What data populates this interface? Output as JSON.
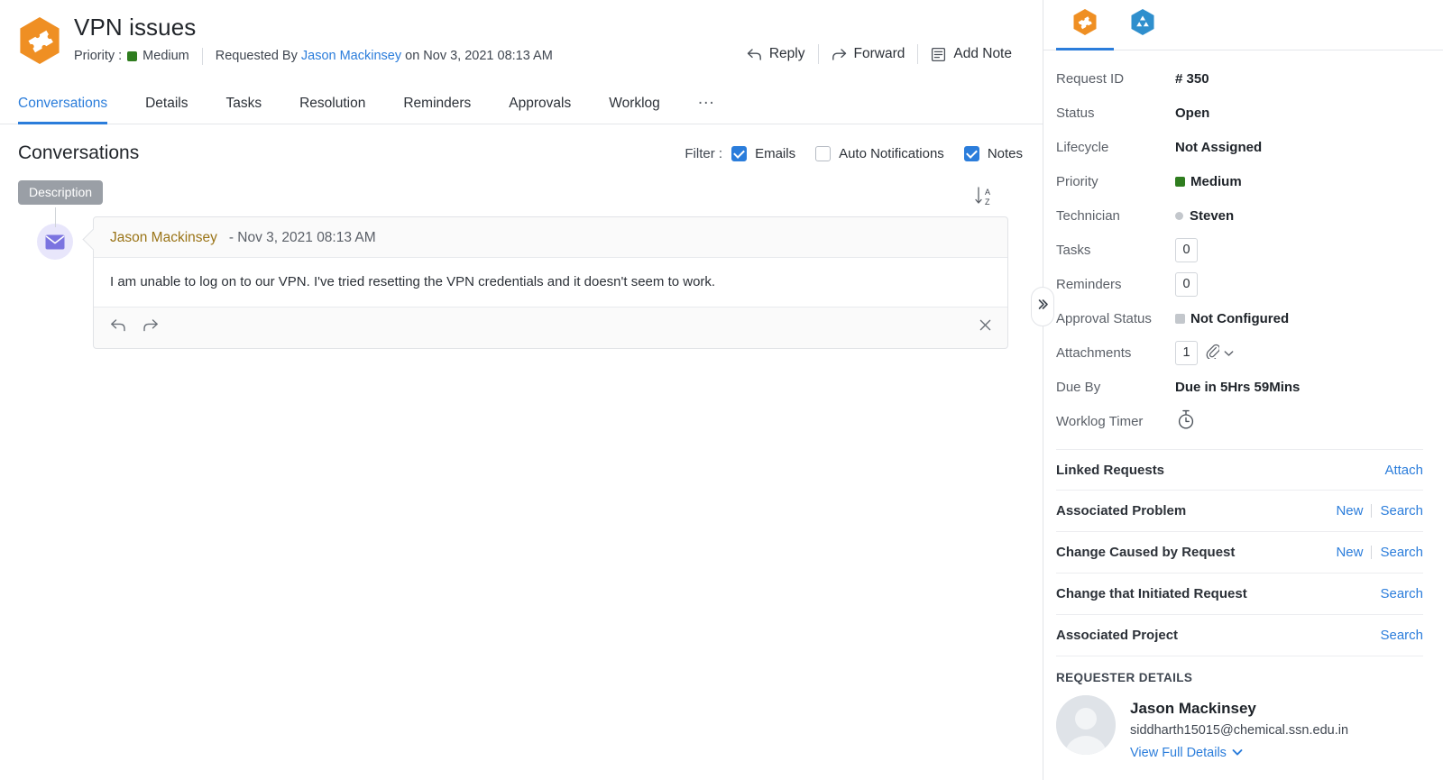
{
  "header": {
    "title": "VPN issues",
    "priority_label": "Priority :",
    "priority_value": "Medium",
    "priority_color": "#2f7d1f",
    "requested_by_label": "Requested By",
    "requester": "Jason Mackinsey",
    "requested_on": "on Nov 3, 2021 08:13 AM",
    "icon": "ticket-hex-icon",
    "actions": [
      {
        "label": "Reply",
        "icon": "reply-arrow-icon"
      },
      {
        "label": "Forward",
        "icon": "forward-arrow-icon"
      },
      {
        "label": "Add Note",
        "icon": "note-icon"
      }
    ]
  },
  "tabs": [
    {
      "label": "Conversations",
      "active": true
    },
    {
      "label": "Details",
      "active": false
    },
    {
      "label": "Tasks",
      "active": false
    },
    {
      "label": "Resolution",
      "active": false
    },
    {
      "label": "Reminders",
      "active": false
    },
    {
      "label": "Approvals",
      "active": false
    },
    {
      "label": "Worklog",
      "active": false
    },
    {
      "label": "...",
      "active": false
    }
  ],
  "conversations": {
    "heading": "Conversations",
    "filter_label": "Filter :",
    "filters": [
      {
        "label": "Emails",
        "checked": true
      },
      {
        "label": "Auto Notifications",
        "checked": false
      },
      {
        "label": "Notes",
        "checked": true
      }
    ],
    "sort_icon": "sort-az-icon",
    "description_badge": "Description",
    "message": {
      "author": "Jason Mackinsey",
      "timestamp": "- Nov 3, 2021 08:13 AM",
      "body": "I am unable to log on to our VPN. I've tried resetting the VPN credentials and it doesn't seem to work.",
      "avatar_icon": "envelope-icon",
      "reply_icon": "reply-arrow-icon",
      "forward_icon": "forward-arrow-icon",
      "close_icon": "close-icon"
    }
  },
  "sidebar": {
    "tabs": [
      {
        "icon": "request-hex-icon",
        "active": true
      },
      {
        "icon": "asset-hex-icon",
        "active": false
      }
    ],
    "properties": [
      {
        "key": "Request ID",
        "value": "# 350",
        "type": "text"
      },
      {
        "key": "Status",
        "value": "Open",
        "type": "text"
      },
      {
        "key": "Lifecycle",
        "value": "Not Assigned",
        "type": "text"
      },
      {
        "key": "Priority",
        "value": "Medium",
        "type": "swatch",
        "color": "#2f7d1f"
      },
      {
        "key": "Technician",
        "value": "Steven",
        "type": "dot"
      },
      {
        "key": "Tasks",
        "value": "0",
        "type": "box"
      },
      {
        "key": "Reminders",
        "value": "0",
        "type": "box"
      },
      {
        "key": "Approval Status",
        "value": "Not Configured",
        "type": "swatch",
        "color": "#c3c7cc"
      },
      {
        "key": "Attachments",
        "value": "1",
        "type": "box-clip"
      },
      {
        "key": "Due By",
        "value": "Due in 5Hrs 59Mins",
        "type": "text"
      },
      {
        "key": "Worklog Timer",
        "value": "",
        "type": "timer"
      }
    ],
    "link_rows": [
      {
        "label": "Linked Requests",
        "actions": [
          "Attach"
        ]
      },
      {
        "label": "Associated Problem",
        "actions": [
          "New",
          "Search"
        ]
      },
      {
        "label": "Change Caused by Request",
        "actions": [
          "New",
          "Search"
        ]
      },
      {
        "label": "Change that Initiated Request",
        "actions": [
          "Search"
        ]
      },
      {
        "label": "Associated Project",
        "actions": [
          "Search"
        ]
      }
    ],
    "requester_details": {
      "heading": "REQUESTER DETAILS",
      "name": "Jason Mackinsey",
      "email": "siddharth15015@chemical.ssn.edu.in",
      "view_full": "View Full Details"
    }
  },
  "collapse_handle_icon": "chevron-double-right-icon"
}
